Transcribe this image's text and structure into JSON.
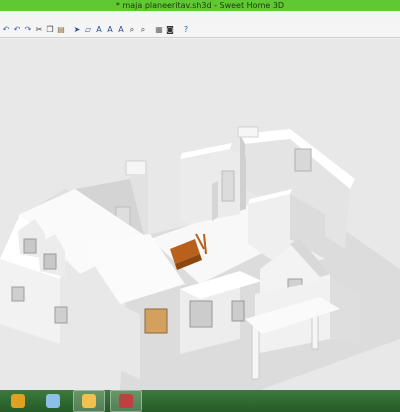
{
  "window": {
    "title": "* maja planeeritav.sh3d - Sweet Home 3D"
  },
  "toolbar": {
    "buttons": [
      {
        "name": "open-icon",
        "glyph": "↶",
        "color": "#3a62b0"
      },
      {
        "name": "undo-icon",
        "glyph": "↶",
        "color": "#3a62b0"
      },
      {
        "name": "redo-icon",
        "glyph": "↷",
        "color": "#3a62b0"
      },
      {
        "name": "cut-icon",
        "glyph": "✂",
        "color": "#444444"
      },
      {
        "name": "copy-icon",
        "glyph": "❐",
        "color": "#444444"
      },
      {
        "name": "paste-icon",
        "glyph": "▤",
        "color": "#8a6a3a"
      },
      {
        "name": "select-icon",
        "glyph": "➤",
        "color": "#2a4f96"
      },
      {
        "name": "create-walls-icon",
        "glyph": "▱",
        "color": "#2a4f96"
      },
      {
        "name": "create-rooms-icon",
        "glyph": "A",
        "color": "#2a4f96"
      },
      {
        "name": "create-dimensions-icon",
        "glyph": "A",
        "color": "#2a4f96"
      },
      {
        "name": "add-text-icon",
        "glyph": "A",
        "color": "#2a4f96"
      },
      {
        "name": "zoom-in-icon",
        "glyph": "⌕",
        "color": "#333333"
      },
      {
        "name": "zoom-out-icon",
        "glyph": "⌕",
        "color": "#333333"
      },
      {
        "name": "plan-lock-icon",
        "glyph": "▦",
        "color": "#666666"
      },
      {
        "name": "create-photo-icon",
        "glyph": "◙",
        "color": "#333333"
      },
      {
        "name": "help-icon",
        "glyph": "?",
        "color": "#2a5fc0"
      }
    ]
  },
  "taskbar": {
    "items": [
      {
        "name": "taskbar-sweethome-icon",
        "active": false,
        "color": "#e0a020"
      },
      {
        "name": "taskbar-phone-icon",
        "active": false,
        "color": "#8cc0e8"
      },
      {
        "name": "taskbar-paint-icon",
        "active": true,
        "color": "#f0c050"
      },
      {
        "name": "taskbar-app-icon",
        "active": true,
        "color": "#c04040"
      }
    ]
  }
}
